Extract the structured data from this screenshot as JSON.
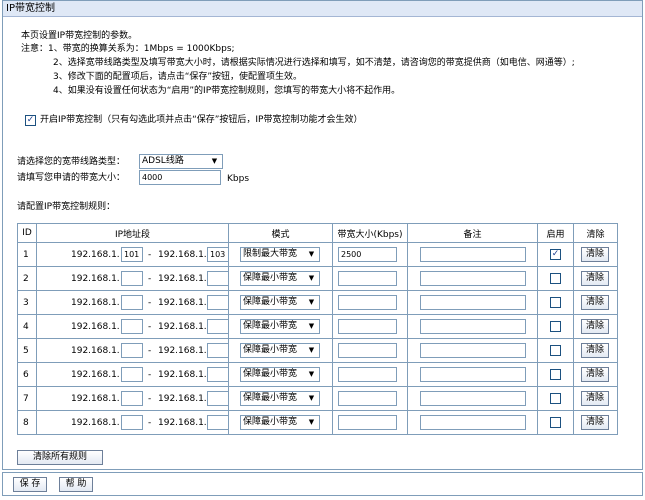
{
  "title": "IP带宽控制",
  "intro": "本页设置IP带宽控制的参数。",
  "notes": [
    "注意：1、带宽的换算关系为：1Mbps = 1000Kbps;",
    "2、选择宽带线路类型及填写带宽大小时，请根据实际情况进行选择和填写，如不清楚，请咨询您的带宽提供商（如电信、网通等）;",
    "3、修改下面的配置项后，请点击“保存”按钮，使配置项生效。",
    "4、如果没有设置任何状态为“启用”的IP带宽控制规则，您填写的带宽大小将不起作用。"
  ],
  "enable": {
    "checked": true,
    "label": "开启IP带宽控制（只有勾选此项并点击“保存”按钮后，IP带宽控制功能才会生效）"
  },
  "line_type": {
    "label": "请选择您的宽带线路类型：",
    "value": "ADSL线路"
  },
  "bandwidth": {
    "label": "请填写您申请的带宽大小：",
    "value": "4000",
    "unit": "Kbps"
  },
  "rules_label": "请配置IP带宽控制规则：",
  "table": {
    "headers": {
      "id": "ID",
      "ip": "IP地址段",
      "mode": "模式",
      "bw": "带宽大小(Kbps)",
      "note": "备注",
      "enable": "启用",
      "clear": "清除"
    },
    "ip_prefix": "192.168.1.",
    "dash": "-",
    "clear_label": "清除",
    "rows": [
      {
        "id": "1",
        "ip_start": "101",
        "ip_end": "103",
        "mode": "限制最大带宽",
        "bw": "2500",
        "note": "",
        "enabled": true
      },
      {
        "id": "2",
        "ip_start": "",
        "ip_end": "",
        "mode": "保障最小带宽",
        "bw": "",
        "note": "",
        "enabled": false
      },
      {
        "id": "3",
        "ip_start": "",
        "ip_end": "",
        "mode": "保障最小带宽",
        "bw": "",
        "note": "",
        "enabled": false
      },
      {
        "id": "4",
        "ip_start": "",
        "ip_end": "",
        "mode": "保障最小带宽",
        "bw": "",
        "note": "",
        "enabled": false
      },
      {
        "id": "5",
        "ip_start": "",
        "ip_end": "",
        "mode": "保障最小带宽",
        "bw": "",
        "note": "",
        "enabled": false
      },
      {
        "id": "6",
        "ip_start": "",
        "ip_end": "",
        "mode": "保障最小带宽",
        "bw": "",
        "note": "",
        "enabled": false
      },
      {
        "id": "7",
        "ip_start": "",
        "ip_end": "",
        "mode": "保障最小带宽",
        "bw": "",
        "note": "",
        "enabled": false
      },
      {
        "id": "8",
        "ip_start": "",
        "ip_end": "",
        "mode": "保障最小带宽",
        "bw": "",
        "note": "",
        "enabled": false
      }
    ]
  },
  "clear_all_label": "清除所有规则",
  "save_label": "保 存",
  "help_label": "帮 助",
  "check_glyph": "✓"
}
